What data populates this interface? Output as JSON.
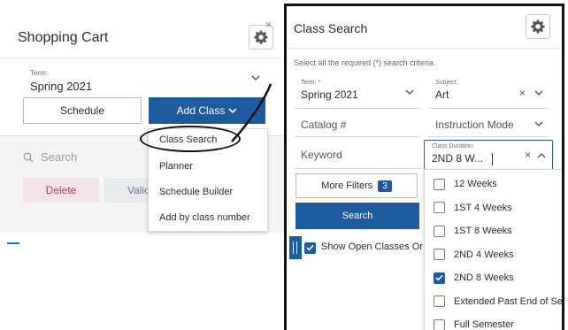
{
  "cart": {
    "title": "Shopping Cart",
    "close_glyph": "×",
    "term_label": "Term:",
    "term_value": "Spring 2021",
    "schedule_label": "Schedule",
    "add_class_label": "Add Class",
    "search_placeholder": "Search",
    "delete_label": "Delete",
    "validate_label": "Valic"
  },
  "add_class_menu": {
    "items": [
      "Class Search",
      "Planner",
      "Schedule Builder",
      "Add by class number"
    ]
  },
  "class_search": {
    "title": "Class Search",
    "hint": "Select all the required (*) search criteria.",
    "term_label": "Term: *",
    "term_value": "Spring 2021",
    "subject_label": "Subject:",
    "subject_value": "Art",
    "catalog_placeholder": "Catalog #",
    "instruction_mode_label": "Instruction Mode",
    "keyword_placeholder": "Keyword",
    "duration_label": "Class Duration:",
    "duration_value": "2ND 8 W...",
    "clear_glyph": "×",
    "more_filters_label": "More Filters",
    "more_filters_count": "3",
    "search_label": "Search",
    "open_classes_label": "Show Open Classes Or",
    "duration_options": [
      {
        "label": "12 Weeks",
        "checked": false
      },
      {
        "label": "1ST 4 Weeks",
        "checked": false
      },
      {
        "label": "1ST 8 Weeks",
        "checked": false
      },
      {
        "label": "2ND 4 Weeks",
        "checked": false
      },
      {
        "label": "2ND 8 Weeks",
        "checked": true
      },
      {
        "label": "Extended Past End of Se",
        "checked": false
      },
      {
        "label": "Full Semester",
        "checked": false
      }
    ]
  },
  "colors": {
    "primary_blue": "#1d5a9e",
    "delete_text": "#b23b4c",
    "outline_black": "#111111"
  },
  "icons": [
    "gear-icon",
    "close-icon",
    "chevron-down-icon",
    "chevron-up-icon",
    "search-icon",
    "checkbox-checked-icon",
    "checkbox-empty-icon",
    "panel-handle-icon"
  ]
}
